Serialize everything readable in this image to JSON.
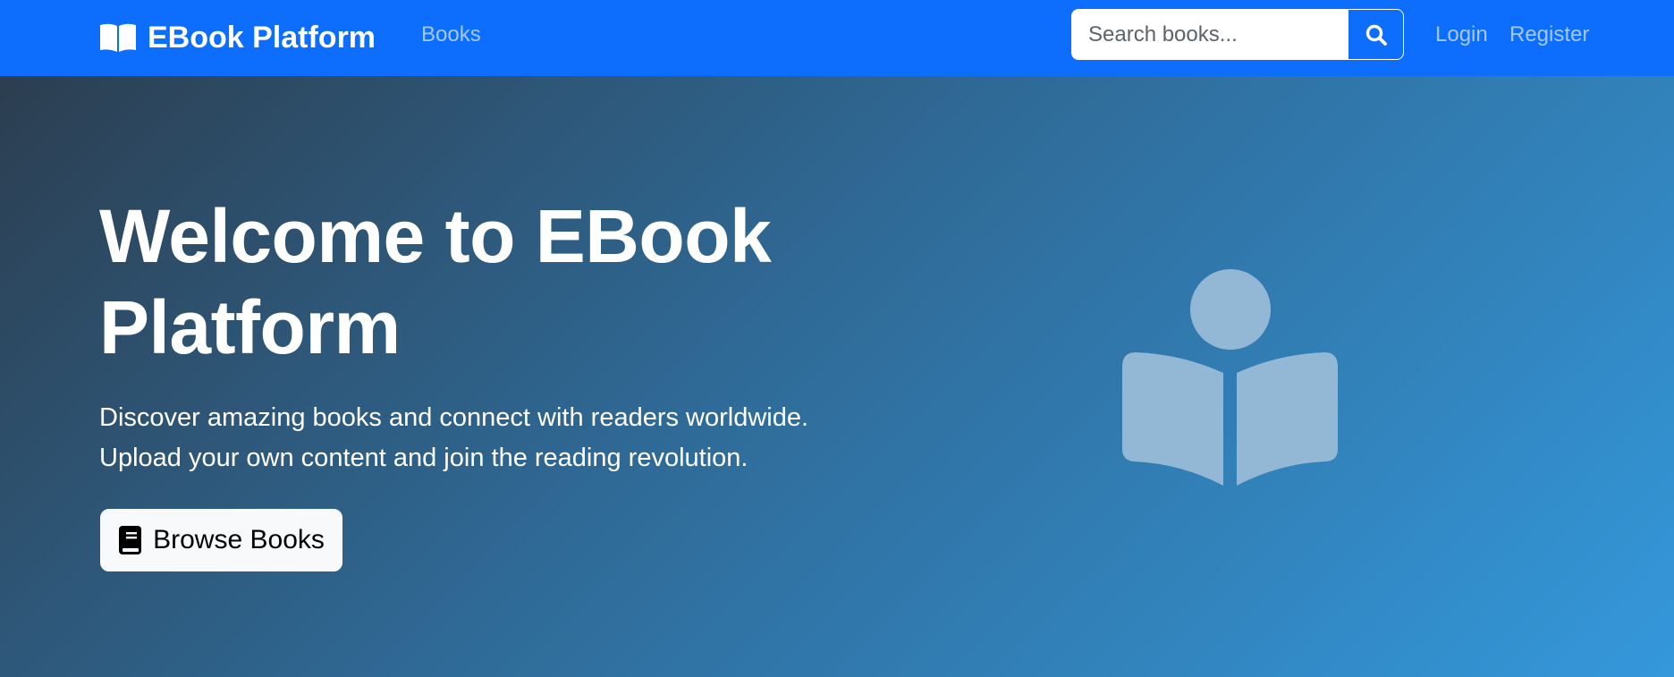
{
  "navbar": {
    "brand": "EBook Platform",
    "brand_icon": "book-open-icon",
    "links": {
      "books": "Books",
      "login": "Login",
      "register": "Register"
    },
    "search": {
      "placeholder": "Search books...",
      "value": "",
      "button_icon": "search-icon"
    }
  },
  "hero": {
    "title": "Welcome to EBook Platform",
    "subtitle_line1": "Discover amazing books and connect with readers worldwide.",
    "subtitle_line2": "Upload your own content and join the reading revolution.",
    "browse_button": {
      "label": "Browse Books",
      "icon": "book-icon"
    },
    "illustration_icon": "reader-icon"
  },
  "colors": {
    "navbar": "#0d6efd",
    "hero_gradient_start": "#2c3e50",
    "hero_gradient_end": "#3498db",
    "nav_link": "#a6c8ff",
    "illustration": "#93b8d5"
  }
}
